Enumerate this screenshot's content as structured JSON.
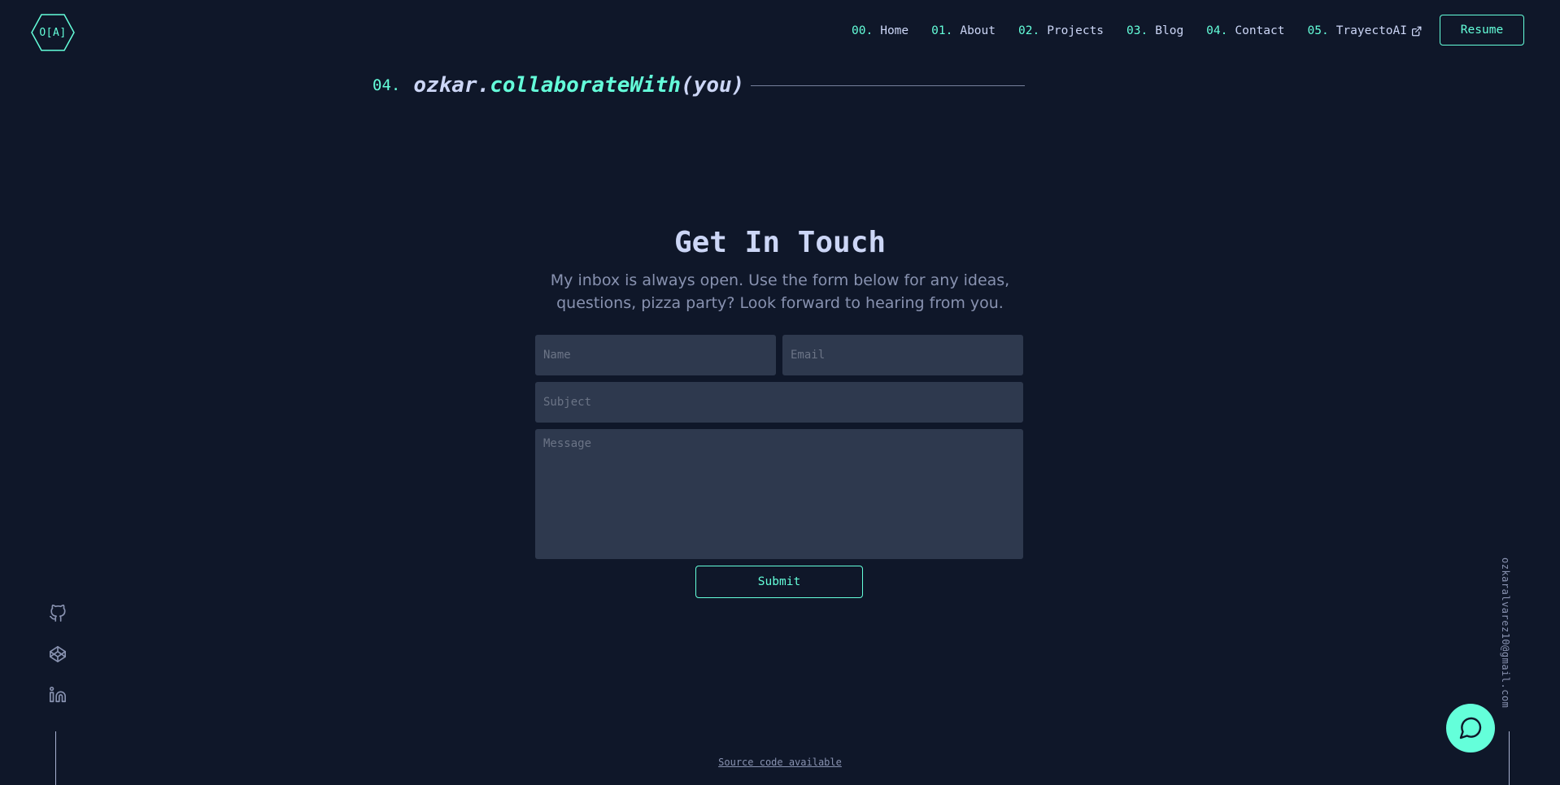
{
  "logo": {
    "text": "O[A]",
    "icon": "hexagon-logo-icon"
  },
  "nav": {
    "items": [
      {
        "num": "00.",
        "label": "Home"
      },
      {
        "num": "01.",
        "label": "About"
      },
      {
        "num": "02.",
        "label": "Projects"
      },
      {
        "num": "03.",
        "label": "Blog"
      },
      {
        "num": "04.",
        "label": "Contact"
      },
      {
        "num": "05.",
        "label": "TrayectoAI",
        "icon": "external-link-icon"
      }
    ],
    "resume_label": "Resume"
  },
  "section": {
    "num": "04.",
    "title_object": "ozkar.",
    "title_method": "collaborateWith",
    "title_args": "(you)"
  },
  "contact": {
    "title": "Get In Touch",
    "description": "My inbox is always open. Use the form below for any ideas, questions, pizza party? Look forward to hearing from you.",
    "form": {
      "name_placeholder": "Name",
      "email_placeholder": "Email",
      "subject_placeholder": "Subject",
      "message_placeholder": "Message",
      "submit_label": "Submit"
    }
  },
  "social": {
    "icons": [
      "github-icon",
      "codepen-icon",
      "linkedin-icon"
    ]
  },
  "email": "ozkaralvarez10@gmail.com",
  "chat": {
    "icon": "chat-bubble-icon"
  },
  "footer": {
    "link_text": "Source code available"
  },
  "colors": {
    "background": "#0f1729",
    "accent": "#64ffda",
    "text": "#ccd6f6",
    "muted": "#8892b0",
    "field": "#2e394e"
  }
}
